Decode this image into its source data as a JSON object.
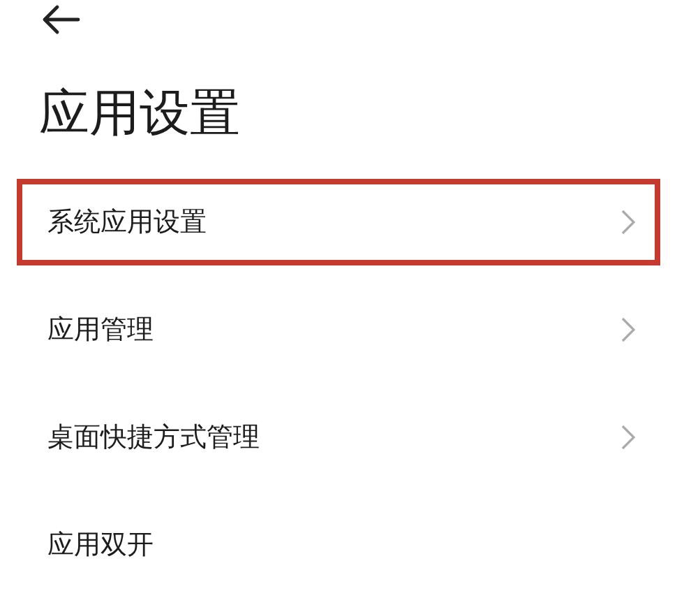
{
  "header": {
    "title": "应用设置"
  },
  "items": [
    {
      "label": "系统应用设置",
      "has_arrow": true,
      "highlighted": true
    },
    {
      "label": "应用管理",
      "has_arrow": true,
      "highlighted": false
    },
    {
      "label": "桌面快捷方式管理",
      "has_arrow": true,
      "highlighted": false
    },
    {
      "label": "应用双开",
      "has_arrow": false,
      "highlighted": false
    }
  ]
}
